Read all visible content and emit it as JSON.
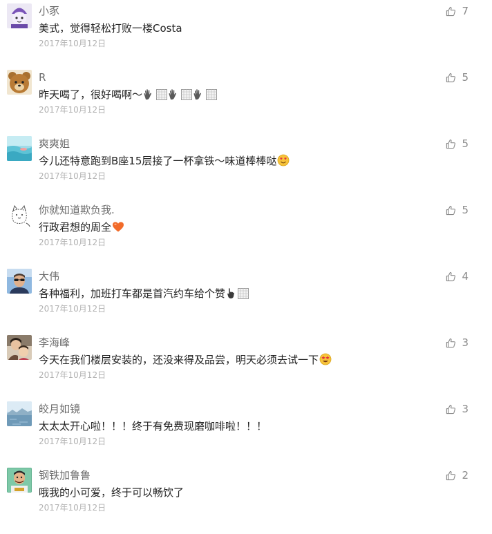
{
  "comments": [
    {
      "nickname": "小豕",
      "content": "美式，觉得轻松打败一楼Costa",
      "date": "2017年10月12日",
      "likes": "7",
      "avatar": "purple-character-avatar"
    },
    {
      "nickname": "R",
      "content": "昨天喝了，很好喝啊～",
      "date": "2017年10月12日",
      "likes": "5",
      "avatar": "brown-bear-avatar",
      "emojis": [
        "clap-icon",
        "clap-icon",
        "clap-icon"
      ]
    },
    {
      "nickname": "爽爽姐",
      "content": "今儿还特意跑到B座15层接了一杯拿铁～味道棒棒哒",
      "date": "2017年10月12日",
      "likes": "5",
      "avatar": "ocean-avatar",
      "emojis": [
        "heart-eyes-emoji"
      ]
    },
    {
      "nickname": "你就知道欺负我.",
      "content": "行政君想的周全",
      "date": "2017年10月12日",
      "likes": "5",
      "avatar": "sketch-cat-avatar",
      "emojis": [
        "orange-heart-emoji"
      ]
    },
    {
      "nickname": "大伟",
      "content": "各种福利，加班打车都是首汽约车给个赞",
      "date": "2017年10月12日",
      "likes": "4",
      "avatar": "man-sunglasses-avatar",
      "emojis": [
        "pointing-hand-icon"
      ]
    },
    {
      "nickname": "李海峰",
      "content": "今天在我们楼层安装的，还没来得及品尝，明天必须去试一下",
      "date": "2017年10月12日",
      "likes": "3",
      "avatar": "family-photo-avatar",
      "emojis": [
        "star-struck-emoji"
      ]
    },
    {
      "nickname": "皎月如镜",
      "content": "太太太开心啦！！！终于有免费现磨咖啡啦！！！",
      "date": "2017年10月12日",
      "likes": "3",
      "avatar": "lake-scenery-avatar"
    },
    {
      "nickname": "钢铁加鲁鲁",
      "content": "哦我的小可爱，终于可以畅饮了",
      "date": "2017年10月12日",
      "likes": "2",
      "avatar": "cartoon-man-avatar"
    }
  ],
  "colors": {
    "nickname": "#6b6b6b",
    "content": "#222222",
    "date": "#b2b2b2",
    "like_icon": "#8a8a8a",
    "heart": "#f26b2a",
    "emoji_face": "#f7c33b"
  },
  "icons": {
    "like": "thumbs-up-icon"
  }
}
